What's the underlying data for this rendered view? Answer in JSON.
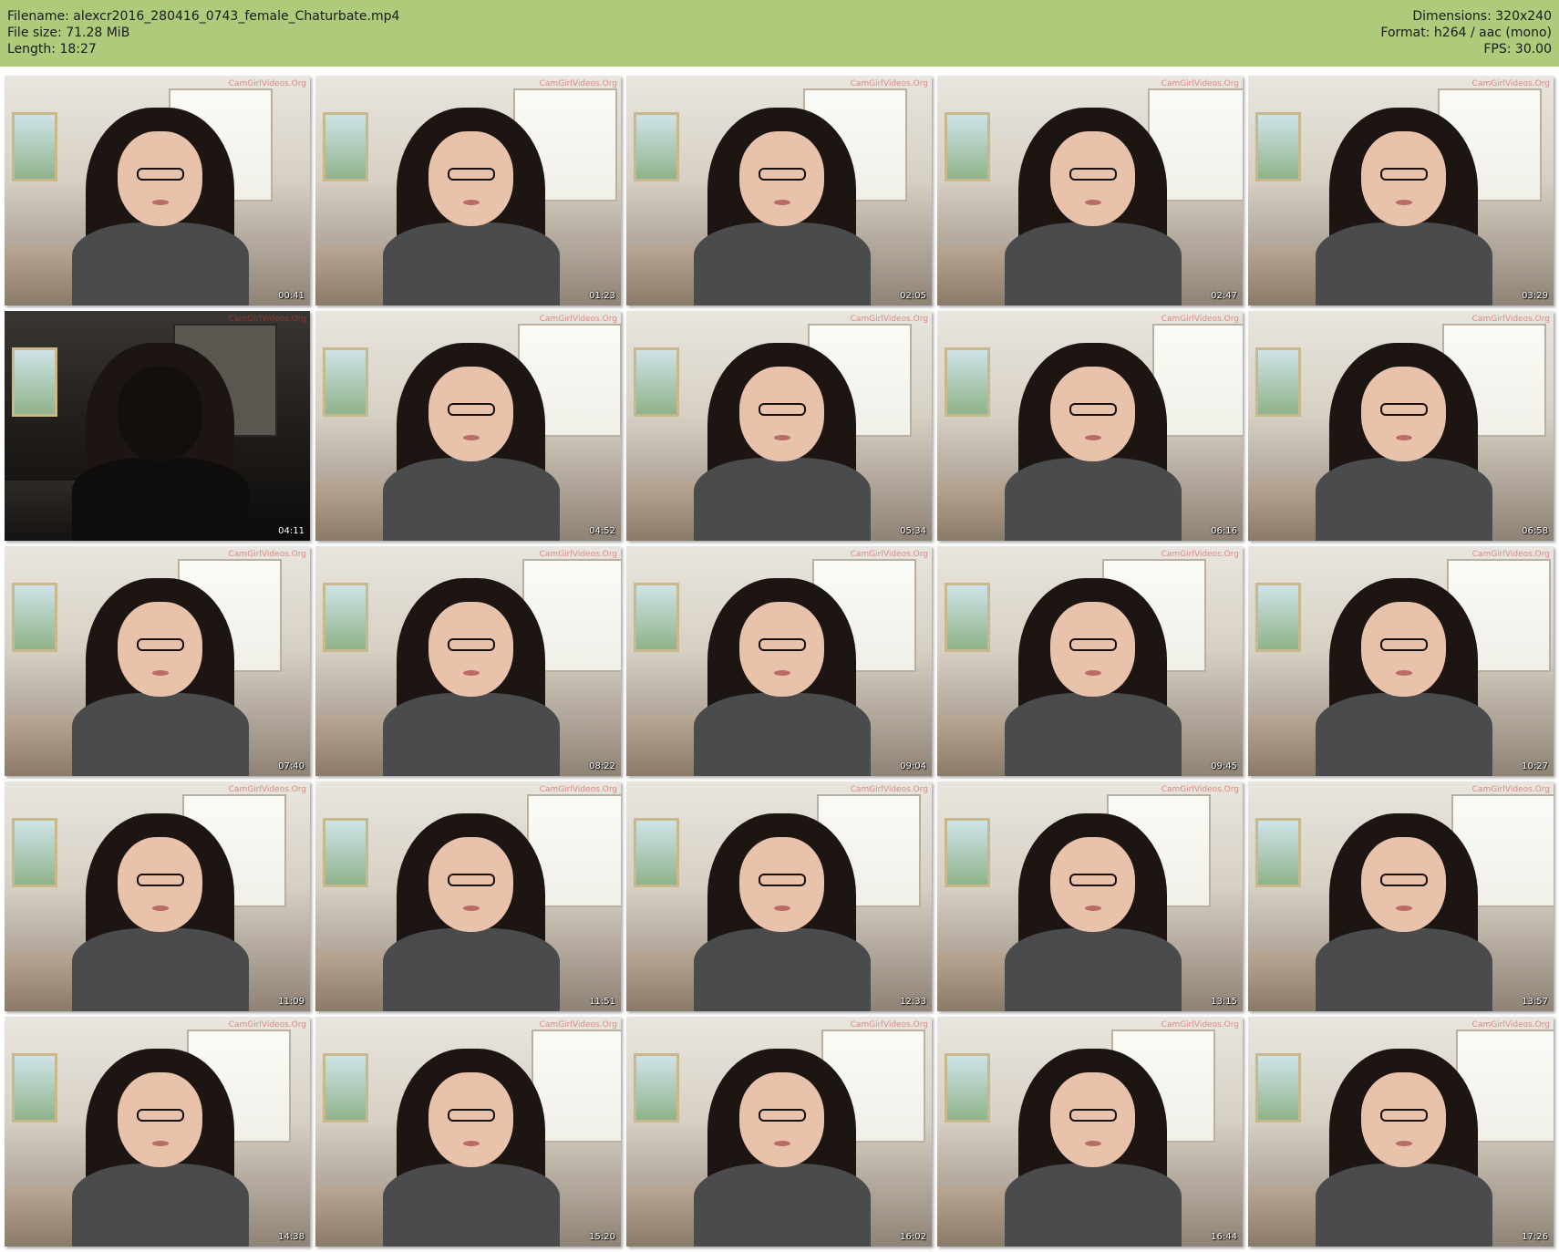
{
  "header": {
    "filename": "Filename: alexcr2016_280416_0743_female_Chaturbate.mp4",
    "filesize": "File size: 71.28 MiB",
    "length": "Length: 18:27",
    "dimensions": "Dimensions: 320x240",
    "format": "Format: h264 / aac (mono)",
    "fps": "FPS: 30.00"
  },
  "watermark_text": "CamGirlVideos.Org",
  "thumbnails": [
    {
      "time": "00:41"
    },
    {
      "time": "01:23"
    },
    {
      "time": "02:05"
    },
    {
      "time": "02:47"
    },
    {
      "time": "03:29"
    },
    {
      "time": "04:11",
      "dark": true
    },
    {
      "time": "04:52"
    },
    {
      "time": "05:34"
    },
    {
      "time": "06:16"
    },
    {
      "time": "06:58"
    },
    {
      "time": "07:40"
    },
    {
      "time": "08:22"
    },
    {
      "time": "09:04"
    },
    {
      "time": "09:45"
    },
    {
      "time": "10:27"
    },
    {
      "time": "11:09"
    },
    {
      "time": "11:51"
    },
    {
      "time": "12:33"
    },
    {
      "time": "13:15"
    },
    {
      "time": "13:57"
    },
    {
      "time": "14:38"
    },
    {
      "time": "15:20"
    },
    {
      "time": "16:02"
    },
    {
      "time": "16:44"
    },
    {
      "time": "17:26"
    }
  ]
}
